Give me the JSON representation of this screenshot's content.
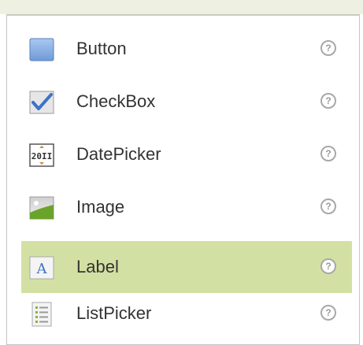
{
  "palette": {
    "items": [
      {
        "label": "Button",
        "icon": "button-icon",
        "selected": false
      },
      {
        "label": "CheckBox",
        "icon": "checkbox-icon",
        "selected": false
      },
      {
        "label": "DatePicker",
        "icon": "datepicker-icon",
        "datepicker_glyph": "20II",
        "selected": false
      },
      {
        "label": "Image",
        "icon": "image-icon",
        "selected": false
      },
      {
        "label": "Label",
        "icon": "label-icon",
        "label_glyph": "A",
        "selected": true
      },
      {
        "label": "ListPicker",
        "icon": "listpicker-icon",
        "selected": false
      }
    ],
    "help_glyph": "?"
  },
  "colors": {
    "selected_row": "#d3e0a3",
    "header_strip": "#eef1e2"
  }
}
